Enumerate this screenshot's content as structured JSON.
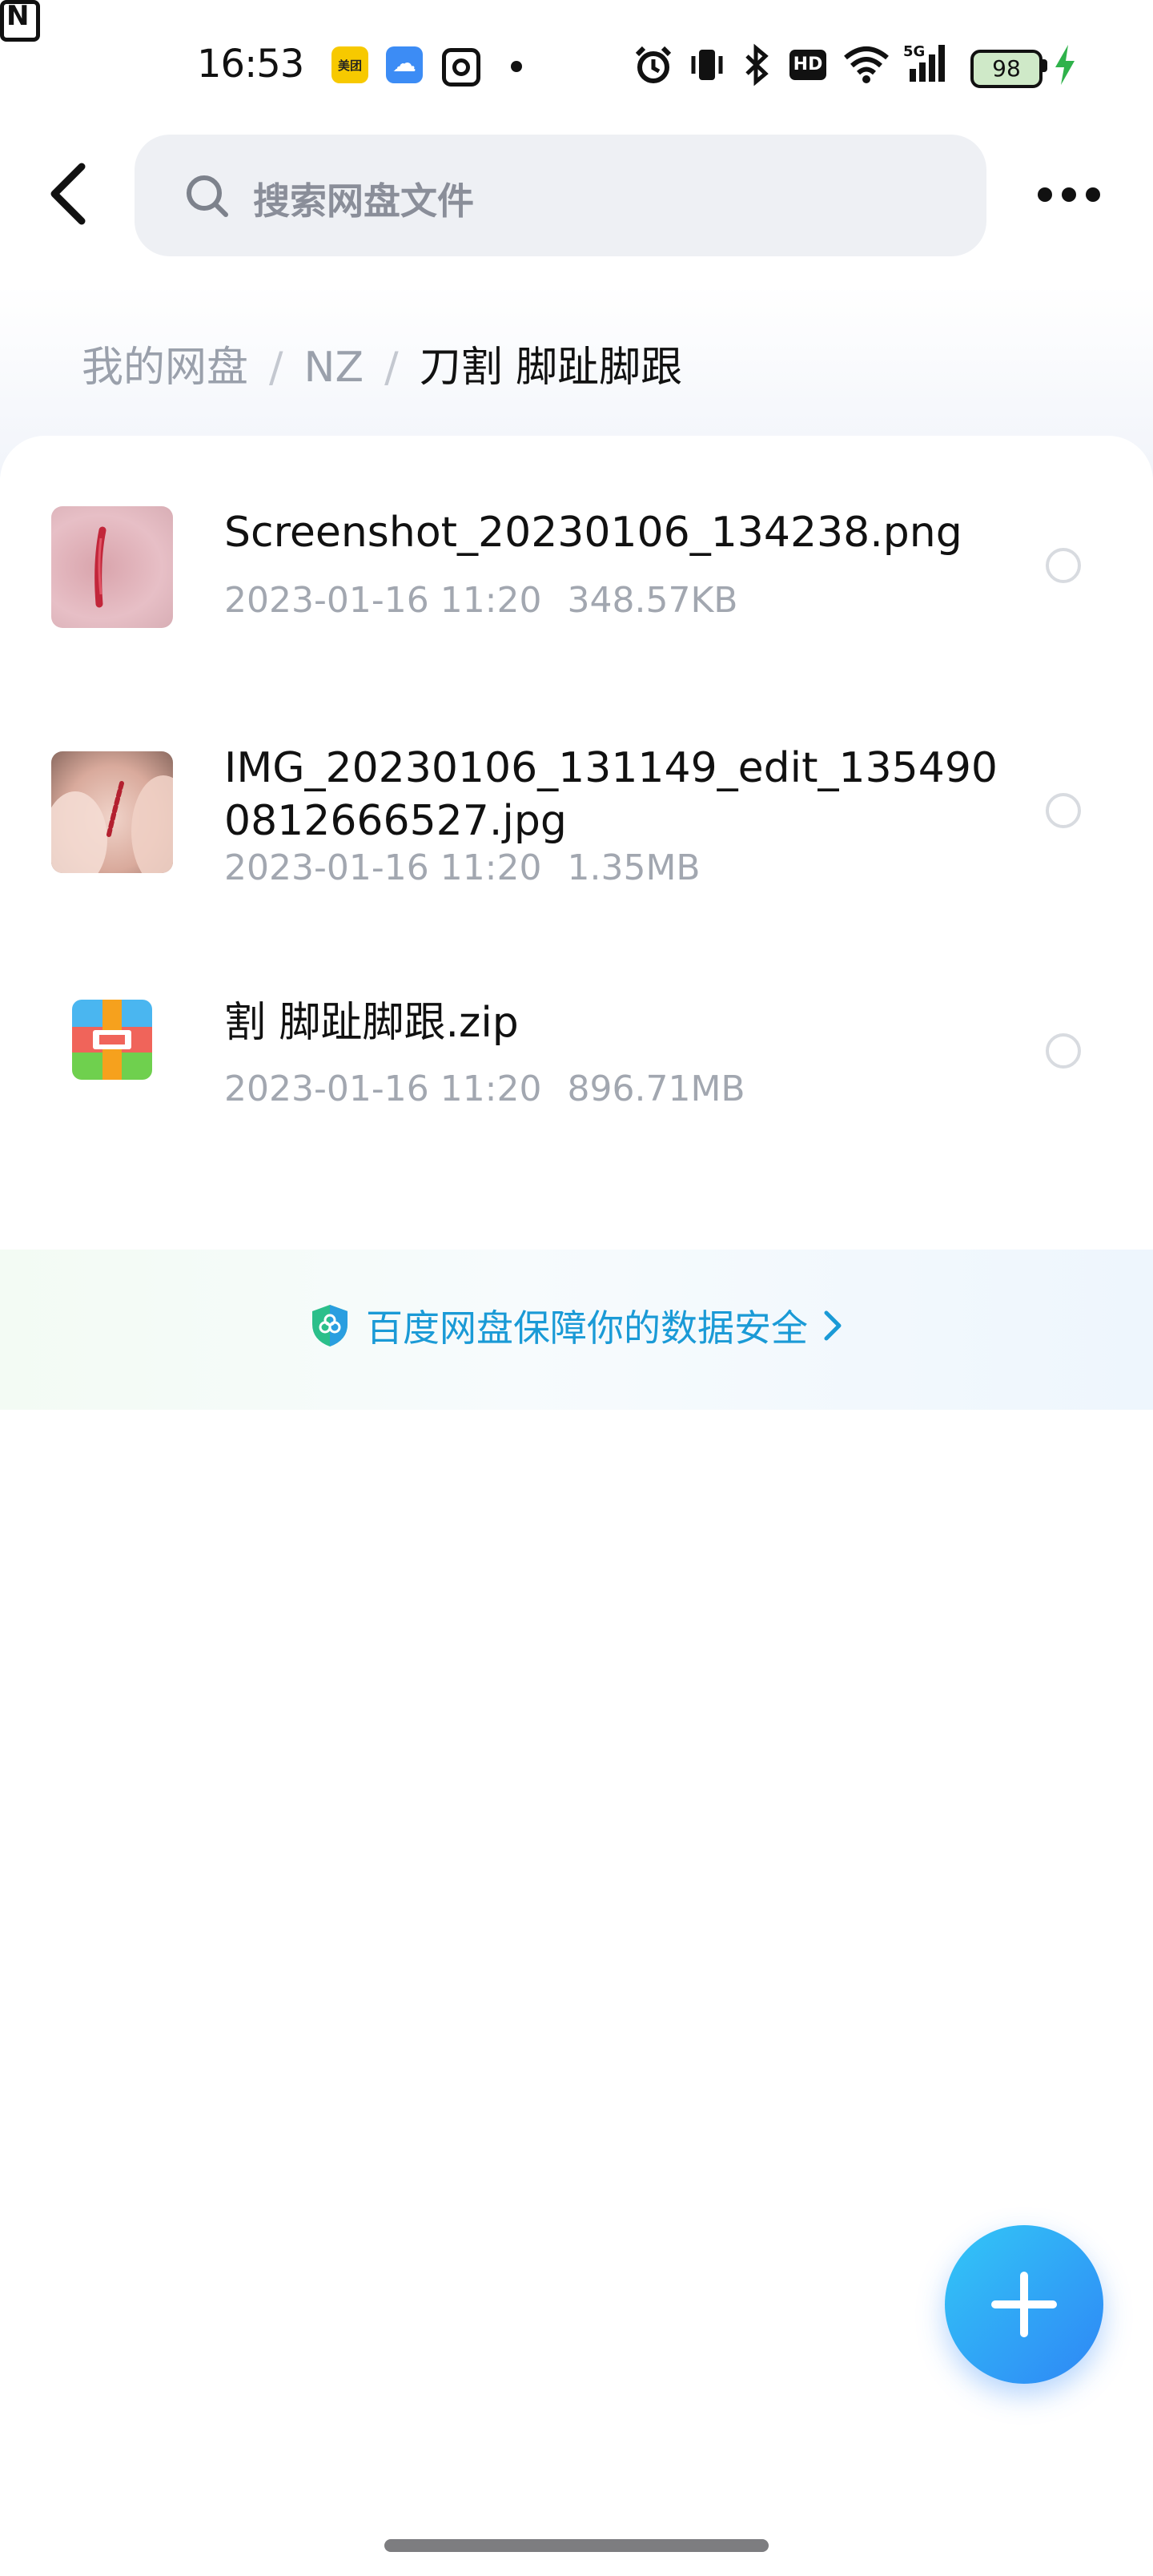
{
  "status_bar": {
    "time": "16:53",
    "meituan_label": "美团",
    "battery": "98",
    "icons": [
      "meituan-app-icon",
      "baidu-netdisk-app-icon",
      "instagram-icon",
      "notification-dot",
      "nfc-icon",
      "alarm-icon",
      "vibrate-icon",
      "bluetooth-icon",
      "hd-icon",
      "wifi-icon",
      "5g-signal-icon",
      "battery-icon",
      "charging-icon"
    ]
  },
  "header": {
    "search_placeholder": "搜索网盘文件"
  },
  "breadcrumb": {
    "root": "我的网盘",
    "separator": "/",
    "parent": "NZ",
    "current": "刀割 脚趾脚跟"
  },
  "files": [
    {
      "name": "Screenshot_20230106_134238.png",
      "date": "2023-01-16  11:20",
      "size": "348.57KB",
      "type": "image"
    },
    {
      "name": "IMG_20230106_131149_edit_1354900812666527.jpg",
      "name_line1": "IMG_20230106_131149_edit_135490",
      "name_line2": "0812666527.jpg",
      "date": "2023-01-16  11:20",
      "size": "1.35MB",
      "type": "image"
    },
    {
      "name": "割 脚趾脚跟.zip",
      "date": "2023-01-16  11:20",
      "size": "896.71MB",
      "type": "zip"
    }
  ],
  "security_banner": {
    "text": "百度网盘保障你的数据安全"
  },
  "colors": {
    "accent": "#1a9ad6",
    "fab_start": "#33c7f7",
    "fab_end": "#2e86f5",
    "search_bg": "#eef0f4"
  }
}
